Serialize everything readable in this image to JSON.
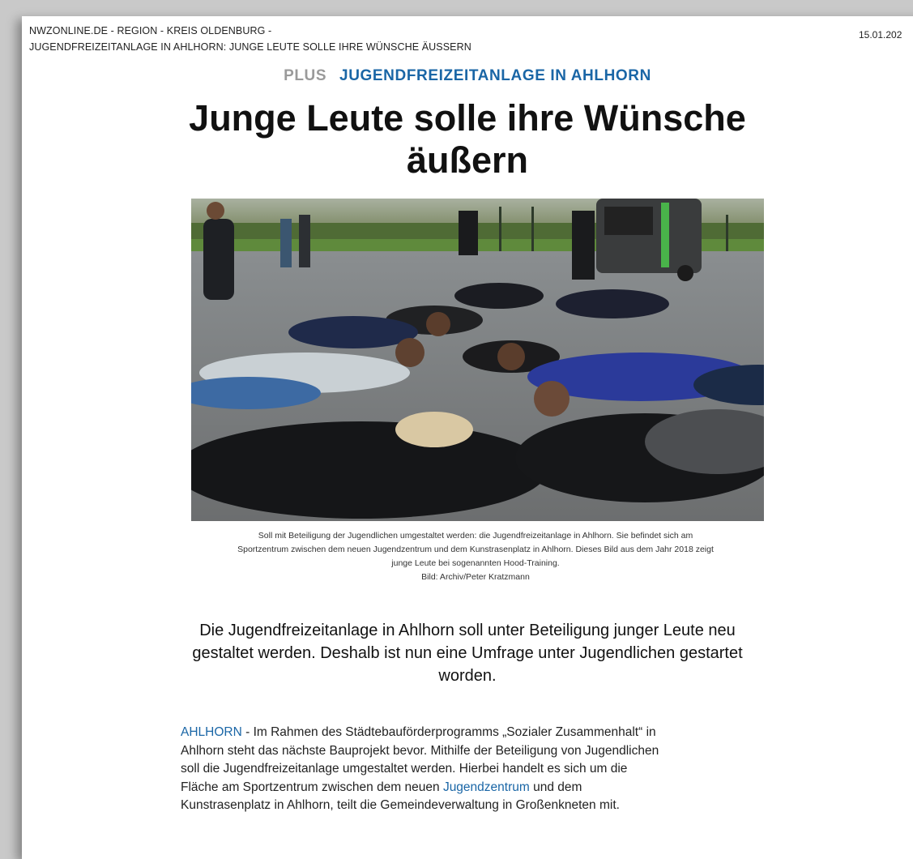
{
  "header": {
    "breadcrumb_line1": "NWZONLINE.DE - REGION - KREIS OLDENBURG -",
    "breadcrumb_line2": "JUGENDFREIZEITANLAGE IN AHLHORN: JUNGE LEUTE SOLLE IHRE WÜNSCHE ÄUSSERN",
    "date": "15.01.202"
  },
  "article": {
    "plus_label": "PLUS",
    "kicker": "JUGENDFREIZEITANLAGE IN AHLHORN",
    "headline_line1": "Junge Leute solle ihre Wünsche",
    "headline_line2": "äußern",
    "image_alt": "Junge Leute bei sogenanntem Hood-Training auf der Jugendfreizeitanlage in Ahlhorn",
    "caption_line1": "Soll mit Beteiligung der Jugendlichen umgestaltet werden: die Jugendfreizeitanlage in Ahlhorn. Sie befindet sich am",
    "caption_line2": "Sportzentrum zwischen dem neuen Jugendzentrum und dem Kunstrasenplatz in Ahlhorn. Dieses Bild aus dem Jahr 2018 zeigt",
    "caption_line3": "junge Leute bei sogenannten Hood-Training.",
    "credit": "Bild: Archiv/Peter Kratzmann",
    "lead_line1": "Die Jugendfreizeitanlage in Ahlhorn soll unter Beteiligung junger Leute neu",
    "lead_line2": "gestaltet werden. Deshalb ist nun eine Umfrage unter Jugendlichen gestartet",
    "lead_line3": "worden.",
    "dateline": "AHLHORN",
    "body_part1": " - Im Rahmen des Städtebauförderprogramms „Sozialer Zusammenhalt“ in Ahlhorn steht das nächste Bauprojekt bevor. Mithilfe der Beteiligung von Jugendlichen soll die Jugendfreizeitanlage umgestaltet werden. Hierbei handelt es sich um die Fläche am Sportzentrum zwischen dem neuen ",
    "body_link": "Jugendzentrum",
    "body_part2": " und dem Kunstrasenplatz in Ahlhorn, teilt die Gemeindeverwaltung in Großenkneten mit."
  },
  "colors": {
    "accent": "#1a66a6",
    "plus": "#9a9a9a"
  }
}
